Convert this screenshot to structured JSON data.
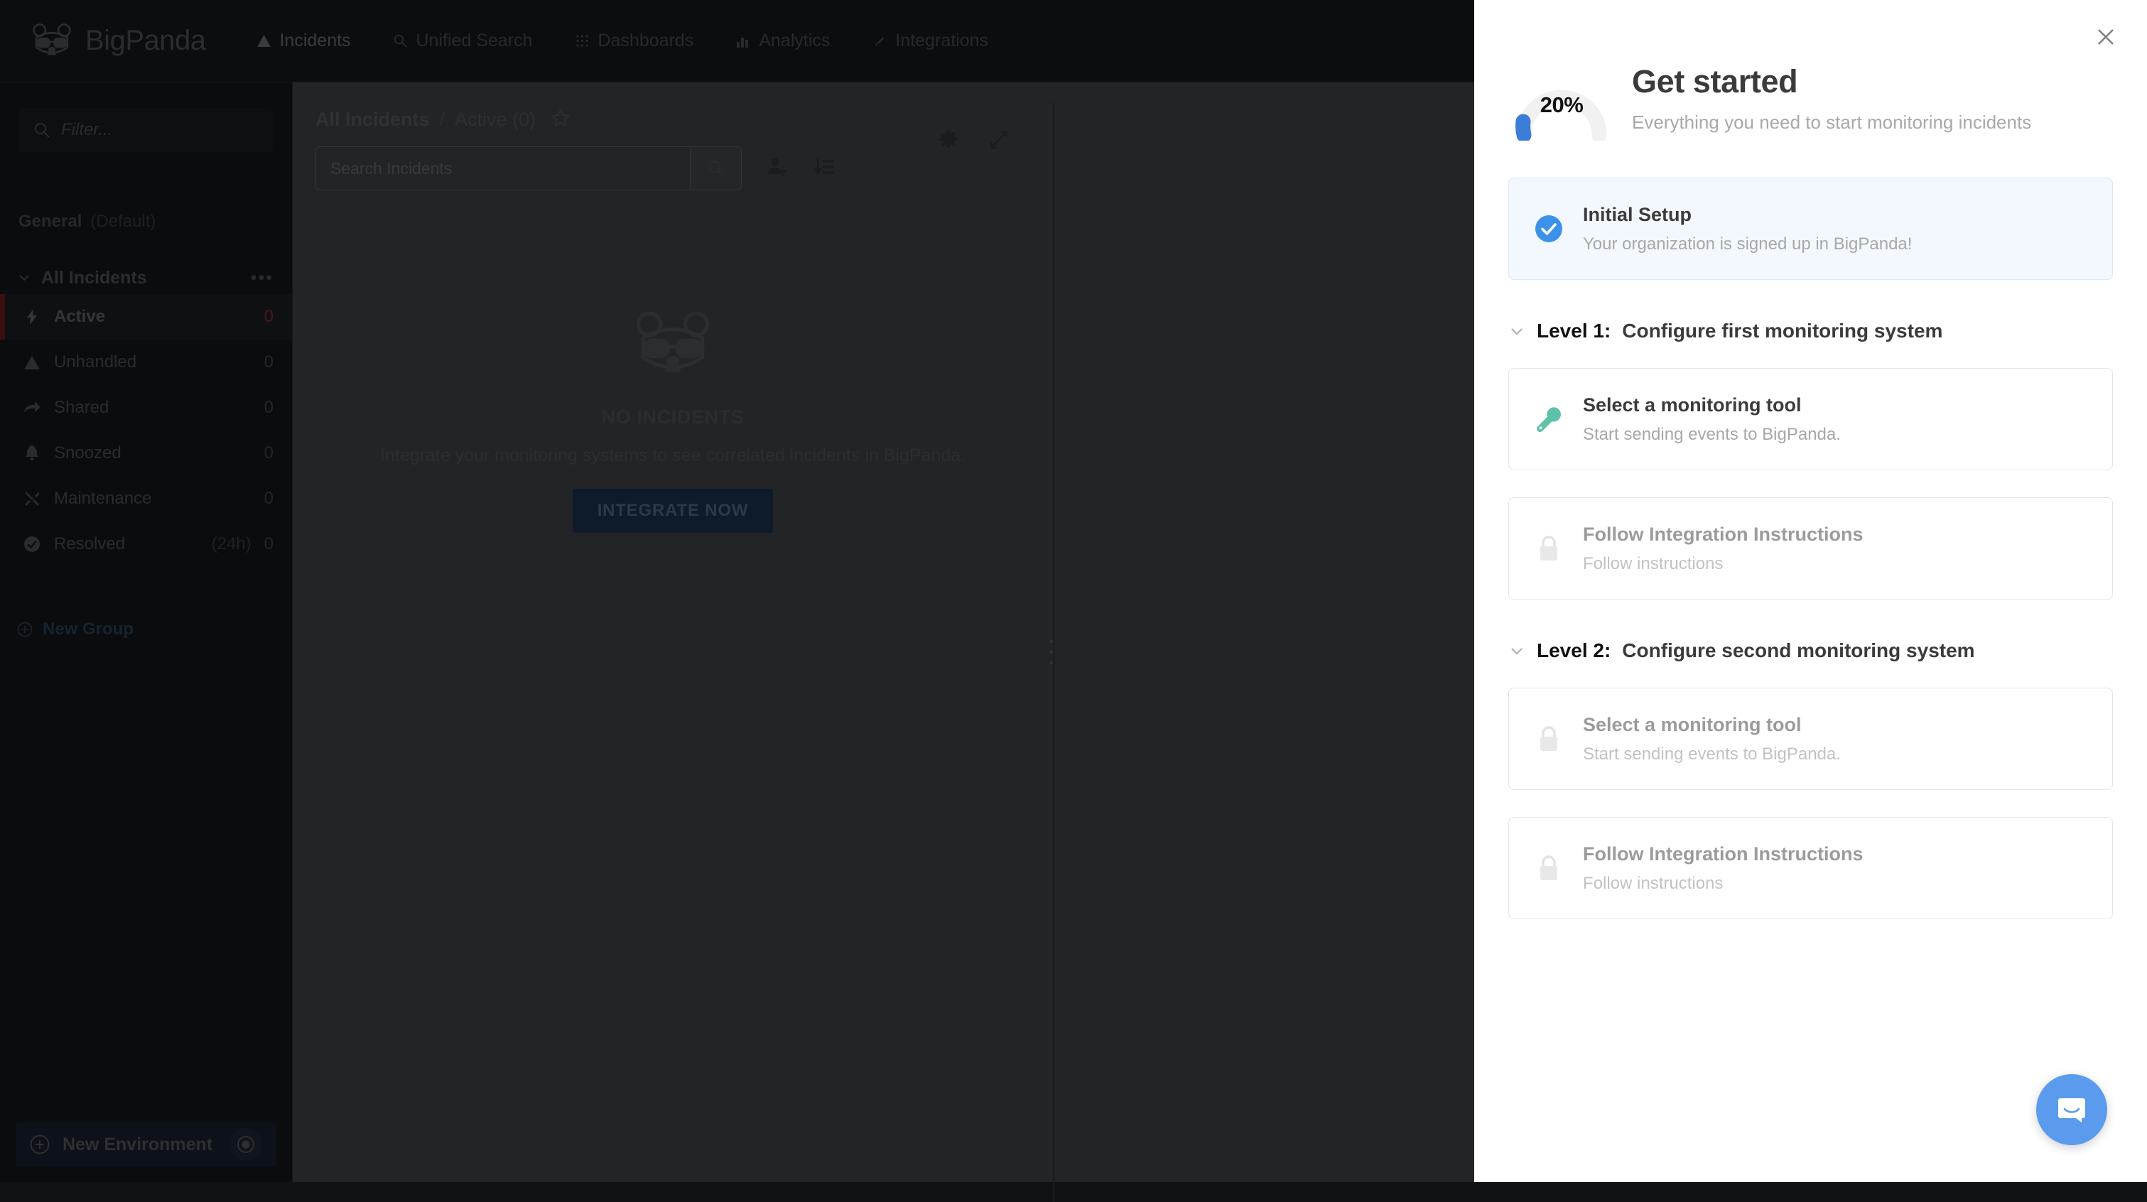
{
  "brand": {
    "name": "BigPanda",
    "logo_icon": "panda-logo-icon"
  },
  "topnav": {
    "items": [
      {
        "label": "Incidents",
        "icon": "warning-triangle-icon",
        "active": true
      },
      {
        "label": "Unified Search",
        "icon": "search-icon",
        "active": false
      },
      {
        "label": "Dashboards",
        "icon": "grid-dots-icon",
        "active": false
      },
      {
        "label": "Analytics",
        "icon": "bar-chart-icon",
        "active": false
      },
      {
        "label": "Integrations",
        "icon": "plug-icon",
        "active": false
      }
    ]
  },
  "sidebar": {
    "filter_placeholder": "Filter...",
    "environment": {
      "name": "General",
      "default_label": "(Default)"
    },
    "group": {
      "title": "All Incidents",
      "menu": "•••"
    },
    "items": [
      {
        "label": "Active",
        "sub": "",
        "count": "0",
        "icon": "lightning-icon",
        "selected": true
      },
      {
        "label": "Unhandled",
        "sub": "",
        "count": "0",
        "icon": "warning-triangle-icon",
        "selected": false
      },
      {
        "label": "Shared",
        "sub": "",
        "count": "0",
        "icon": "share-arrow-icon",
        "selected": false
      },
      {
        "label": "Snoozed",
        "sub": "",
        "count": "0",
        "icon": "bell-icon",
        "selected": false
      },
      {
        "label": "Maintenance",
        "sub": "",
        "count": "0",
        "icon": "tools-icon",
        "selected": false
      },
      {
        "label": "Resolved",
        "sub": "(24h)",
        "count": "0",
        "icon": "check-circle-icon",
        "selected": false
      }
    ],
    "new_group_label": "New Group",
    "new_environment_label": "New Environment"
  },
  "main": {
    "breadcrumb": {
      "parent": "All Incidents",
      "separator": "/",
      "current": "Active (0)"
    },
    "search_placeholder": "Search Incidents",
    "empty_state": {
      "title": "NO INCIDENTS",
      "subtitle": "Integrate your monitoring systems to see correlated incidents in BigPanda.",
      "cta_label": "INTEGRATE NOW"
    }
  },
  "panel": {
    "close_icon": "close-icon",
    "progress": {
      "percent_label": "20%",
      "value": 20,
      "accent_color": "#3b7dd8",
      "track_color": "#f0f0f0"
    },
    "title": "Get started",
    "subtitle": "Everything you need to start monitoring incidents",
    "initial_card": {
      "title": "Initial Setup",
      "subtitle": "Your organization is signed up in BigPanda!",
      "icon": "check-circle-filled-icon",
      "state": "done"
    },
    "levels": [
      {
        "number": "Level 1:",
        "title": "Configure first monitoring system",
        "chevron_icon": "chevron-down-icon",
        "cards": [
          {
            "title": "Select a monitoring tool",
            "subtitle": "Start sending events to BigPanda.",
            "icon": "wrench-icon",
            "state": "available"
          },
          {
            "title": "Follow Integration Instructions",
            "subtitle": "Follow instructions",
            "icon": "lock-icon",
            "state": "locked"
          }
        ]
      },
      {
        "number": "Level 2:",
        "title": "Configure second monitoring system",
        "chevron_icon": "chevron-down-icon",
        "cards": [
          {
            "title": "Select a monitoring tool",
            "subtitle": "Start sending events to BigPanda.",
            "icon": "lock-icon",
            "state": "locked"
          },
          {
            "title": "Follow Integration Instructions",
            "subtitle": "Follow instructions",
            "icon": "lock-icon",
            "state": "locked"
          }
        ]
      }
    ],
    "intercom": {
      "icon": "intercom-chat-icon",
      "color": "#5b9bed"
    }
  }
}
